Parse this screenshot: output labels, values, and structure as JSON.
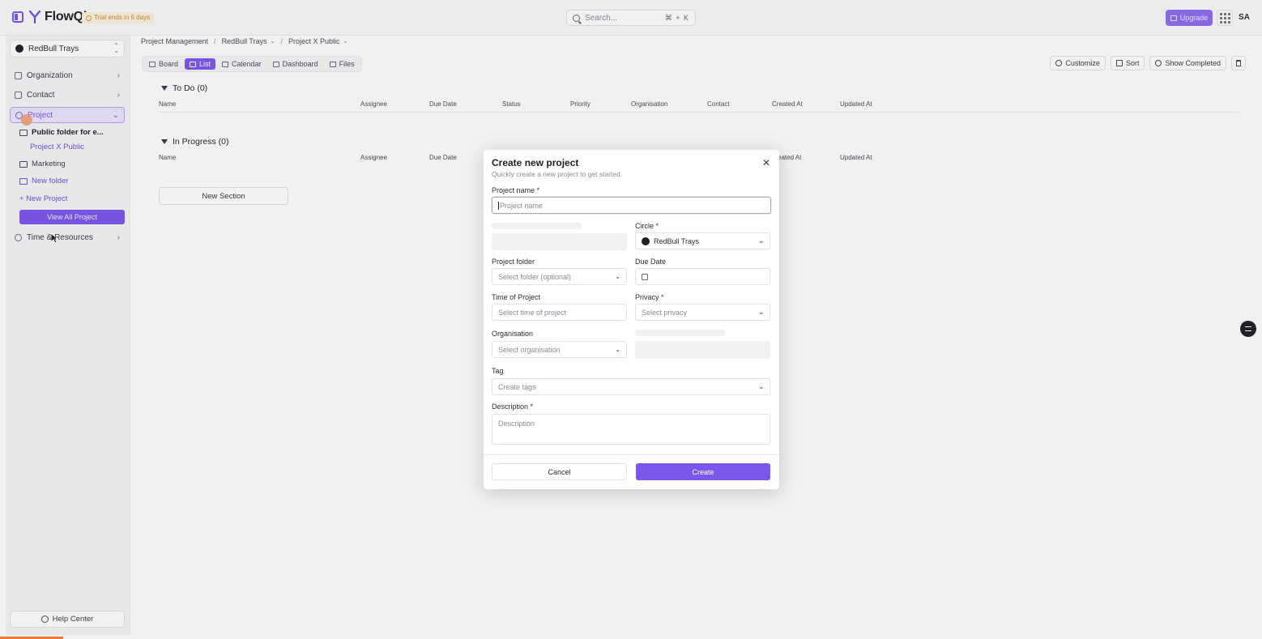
{
  "app": {
    "name": "FlowQi",
    "trial_badge": "Trial ends in 6 days"
  },
  "search": {
    "placeholder": "Search...",
    "shortcut": "⌘ + K"
  },
  "topbar": {
    "upgrade_label": "Upgrade",
    "avatar_initials": "SA"
  },
  "sidebar": {
    "workspace": "RedBull Trays",
    "nav": [
      {
        "label": "Organization",
        "icon": "building-icon"
      },
      {
        "label": "Contact",
        "icon": "user-icon"
      },
      {
        "label": "Project",
        "icon": "gear-icon"
      },
      {
        "label": "Time & Resources",
        "icon": "clock-icon"
      }
    ],
    "tree": {
      "public_folder": "Public folder for e...",
      "project_x": "Project X Public",
      "marketing": "Marketing",
      "new_folder": "New folder",
      "new_project": "+ New Project"
    },
    "view_all": "View All Project",
    "help": "Help Center"
  },
  "breadcrumbs": [
    "Project Management",
    "RedBull Trays",
    "Project X Public"
  ],
  "views": [
    "Board",
    "List",
    "Calendar",
    "Dashboard",
    "Files"
  ],
  "active_view": "List",
  "actions": [
    "Customize",
    "Sort",
    "Show Completed"
  ],
  "sections": [
    {
      "title": "To Do (0)"
    },
    {
      "title": "In Progress (0)"
    }
  ],
  "columns": [
    "Name",
    "Assignee",
    "Due Date",
    "Status",
    "Priority",
    "Organisation",
    "Contact",
    "Created At",
    "Updated At"
  ],
  "columns_partial": [
    "Name",
    "Assignee",
    "Due Date",
    "eated At",
    "Updated At"
  ],
  "new_section": "New Section",
  "modal": {
    "title": "Create new project",
    "subtitle": "Quickly create a new project to get started.",
    "project_name_label": "Project name",
    "project_name_placeholder": "Project name",
    "circle_label": "Circle",
    "circle_value": "RedBull Trays",
    "project_folder_label": "Project folder",
    "project_folder_placeholder": "Select folder (optional)",
    "due_date_label": "Due Date",
    "time_label": "Time of Project",
    "time_placeholder": "Select time of project",
    "privacy_label": "Privacy",
    "privacy_placeholder": "Select privacy",
    "organisation_label": "Organisation",
    "organisation_placeholder": "Select organisation",
    "tag_label": "Tag",
    "tag_placeholder": "Create tags",
    "description_label": "Description",
    "description_placeholder": "Description",
    "required_mark": "*",
    "cancel": "Cancel",
    "create": "Create"
  },
  "colors": {
    "accent": "#7b57e9",
    "progress": "#ef7a3d"
  }
}
